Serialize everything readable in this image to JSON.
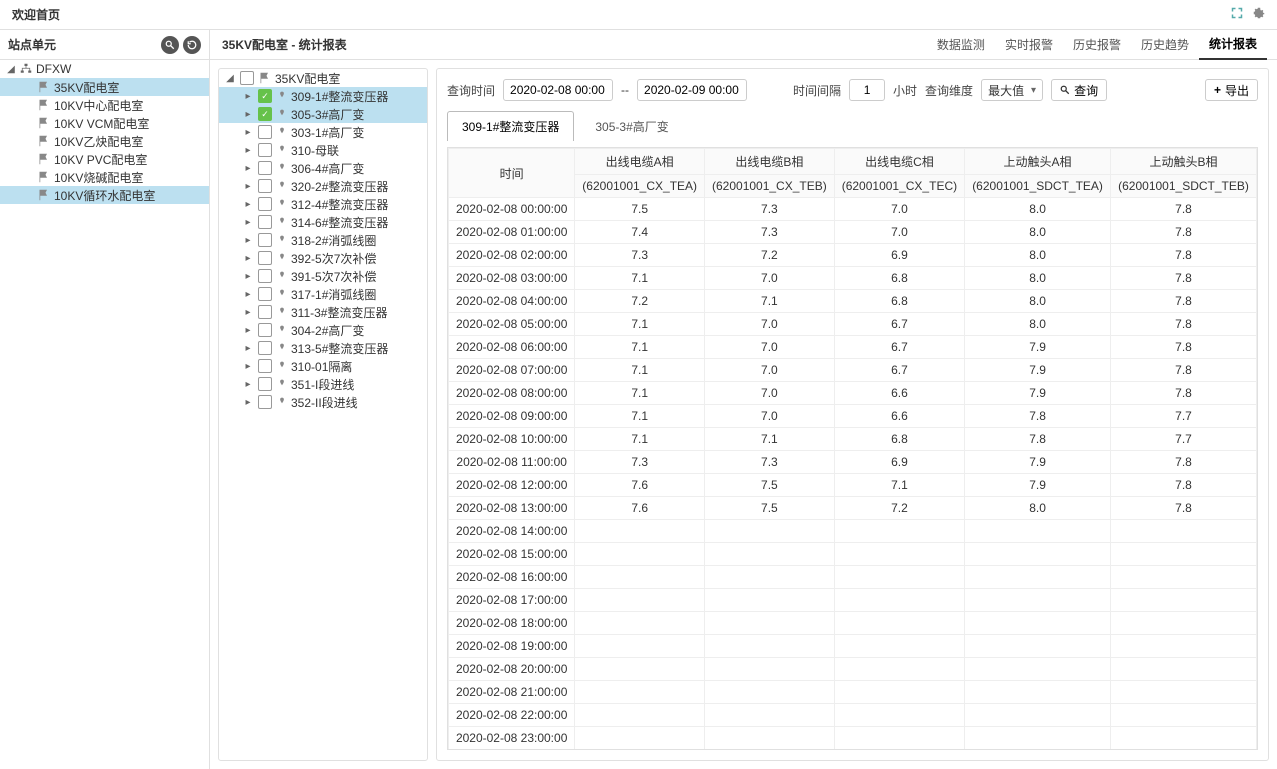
{
  "topbar": {
    "title": "欢迎首页"
  },
  "left": {
    "header": "站点单元",
    "root": "DFXW",
    "items": [
      {
        "label": "35KV配电室",
        "selected": true
      },
      {
        "label": "10KV中心配电室"
      },
      {
        "label": "10KV VCM配电室"
      },
      {
        "label": "10KV乙炔配电室"
      },
      {
        "label": "10KV PVC配电室"
      },
      {
        "label": "10KV烧碱配电室"
      },
      {
        "label": "10KV循环水配电室",
        "highlight": true
      }
    ]
  },
  "center": {
    "breadcrumb": "35KV配电室 - 统计报表",
    "navTabs": [
      "数据监测",
      "实时报警",
      "历史报警",
      "历史趋势",
      "统计报表"
    ],
    "activeNavTab": "统计报表"
  },
  "midTree": {
    "root": "35KV配电室",
    "items": [
      {
        "label": "309-1#整流变压器",
        "checked": true,
        "selected": true
      },
      {
        "label": "305-3#高厂变",
        "checked": true,
        "selected": true
      },
      {
        "label": "303-1#高厂变"
      },
      {
        "label": "310-母联"
      },
      {
        "label": "306-4#高厂变"
      },
      {
        "label": "320-2#整流变压器"
      },
      {
        "label": "312-4#整流变压器"
      },
      {
        "label": "314-6#整流变压器"
      },
      {
        "label": "318-2#消弧线圈"
      },
      {
        "label": "392-5次7次补偿"
      },
      {
        "label": "391-5次7次补偿"
      },
      {
        "label": "317-1#消弧线圈"
      },
      {
        "label": "311-3#整流变压器"
      },
      {
        "label": "304-2#高厂变"
      },
      {
        "label": "313-5#整流变压器"
      },
      {
        "label": "310-01隔离"
      },
      {
        "label": "351-I段进线"
      },
      {
        "label": "352-II段进线"
      }
    ]
  },
  "query": {
    "timeLabel": "查询时间",
    "startValue": "2020-02-08 00:00",
    "sep": "--",
    "endValue": "2020-02-09 00:00",
    "intervalLabel": "时间间隔",
    "intervalValue": "1",
    "intervalUnit": "小时",
    "dimLabel": "查询维度",
    "dimValue": "最大值",
    "queryBtn": "查询",
    "exportBtn": "导出"
  },
  "subTabs": {
    "tabs": [
      "309-1#整流变压器",
      "305-3#高厂变"
    ],
    "active": "309-1#整流变压器"
  },
  "table": {
    "headers": [
      {
        "top": "时间",
        "bottom": ""
      },
      {
        "top": "出线电缆A相",
        "bottom": "(62001001_CX_TEA)"
      },
      {
        "top": "出线电缆B相",
        "bottom": "(62001001_CX_TEB)"
      },
      {
        "top": "出线电缆C相",
        "bottom": "(62001001_CX_TEC)"
      },
      {
        "top": "上动触头A相",
        "bottom": "(62001001_SDCT_TEA)"
      },
      {
        "top": "上动触头B相",
        "bottom": "(62001001_SDCT_TEB)"
      }
    ],
    "rows": [
      {
        "t": "2020-02-08 00:00:00",
        "v": [
          "7.5",
          "7.3",
          "7.0",
          "8.0",
          "7.8"
        ]
      },
      {
        "t": "2020-02-08 01:00:00",
        "v": [
          "7.4",
          "7.3",
          "7.0",
          "8.0",
          "7.8"
        ]
      },
      {
        "t": "2020-02-08 02:00:00",
        "v": [
          "7.3",
          "7.2",
          "6.9",
          "8.0",
          "7.8"
        ]
      },
      {
        "t": "2020-02-08 03:00:00",
        "v": [
          "7.1",
          "7.0",
          "6.8",
          "8.0",
          "7.8"
        ]
      },
      {
        "t": "2020-02-08 04:00:00",
        "v": [
          "7.2",
          "7.1",
          "6.8",
          "8.0",
          "7.8"
        ]
      },
      {
        "t": "2020-02-08 05:00:00",
        "v": [
          "7.1",
          "7.0",
          "6.7",
          "8.0",
          "7.8"
        ]
      },
      {
        "t": "2020-02-08 06:00:00",
        "v": [
          "7.1",
          "7.0",
          "6.7",
          "7.9",
          "7.8"
        ]
      },
      {
        "t": "2020-02-08 07:00:00",
        "v": [
          "7.1",
          "7.0",
          "6.7",
          "7.9",
          "7.8"
        ]
      },
      {
        "t": "2020-02-08 08:00:00",
        "v": [
          "7.1",
          "7.0",
          "6.6",
          "7.9",
          "7.8"
        ]
      },
      {
        "t": "2020-02-08 09:00:00",
        "v": [
          "7.1",
          "7.0",
          "6.6",
          "7.8",
          "7.7"
        ]
      },
      {
        "t": "2020-02-08 10:00:00",
        "v": [
          "7.1",
          "7.1",
          "6.8",
          "7.8",
          "7.7"
        ]
      },
      {
        "t": "2020-02-08 11:00:00",
        "v": [
          "7.3",
          "7.3",
          "6.9",
          "7.9",
          "7.8"
        ]
      },
      {
        "t": "2020-02-08 12:00:00",
        "v": [
          "7.6",
          "7.5",
          "7.1",
          "7.9",
          "7.8"
        ]
      },
      {
        "t": "2020-02-08 13:00:00",
        "v": [
          "7.6",
          "7.5",
          "7.2",
          "8.0",
          "7.8"
        ]
      },
      {
        "t": "2020-02-08 14:00:00",
        "v": [
          "",
          "",
          "",
          "",
          ""
        ]
      },
      {
        "t": "2020-02-08 15:00:00",
        "v": [
          "",
          "",
          "",
          "",
          ""
        ]
      },
      {
        "t": "2020-02-08 16:00:00",
        "v": [
          "",
          "",
          "",
          "",
          ""
        ]
      },
      {
        "t": "2020-02-08 17:00:00",
        "v": [
          "",
          "",
          "",
          "",
          ""
        ]
      },
      {
        "t": "2020-02-08 18:00:00",
        "v": [
          "",
          "",
          "",
          "",
          ""
        ]
      },
      {
        "t": "2020-02-08 19:00:00",
        "v": [
          "",
          "",
          "",
          "",
          ""
        ]
      },
      {
        "t": "2020-02-08 20:00:00",
        "v": [
          "",
          "",
          "",
          "",
          ""
        ]
      },
      {
        "t": "2020-02-08 21:00:00",
        "v": [
          "",
          "",
          "",
          "",
          ""
        ]
      },
      {
        "t": "2020-02-08 22:00:00",
        "v": [
          "",
          "",
          "",
          "",
          ""
        ]
      },
      {
        "t": "2020-02-08 23:00:00",
        "v": [
          "",
          "",
          "",
          "",
          ""
        ]
      }
    ]
  }
}
